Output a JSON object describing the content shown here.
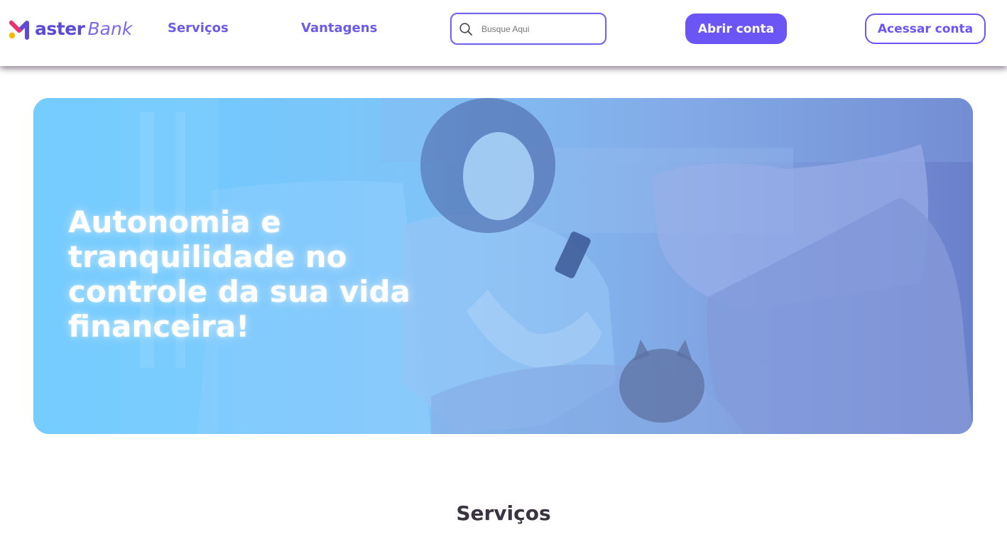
{
  "brand": {
    "name_part1": "aster",
    "name_part2": "Bank",
    "logo_icon": "m-logo-icon",
    "colors": {
      "primary": "#6b56f5",
      "logo_magenta": "#e8336d",
      "logo_yellow": "#f5b800",
      "logo_violet": "#5b4bd6"
    }
  },
  "nav": {
    "items": [
      {
        "label": "Serviços"
      },
      {
        "label": "Vantagens"
      }
    ]
  },
  "search": {
    "placeholder": "Busque Aqui",
    "value": "",
    "icon": "search-icon"
  },
  "actions": {
    "open_account": "Abrir conta",
    "access_account": "Acessar conta"
  },
  "hero": {
    "title": "Autonomia e tranquilidade no controle da sua vida financeira!",
    "image_description_icon": "hero-photo",
    "gradient_colors": [
      "#6cc8ff",
      "#6f83cc"
    ]
  },
  "sections": {
    "services_title": "Serviços"
  }
}
